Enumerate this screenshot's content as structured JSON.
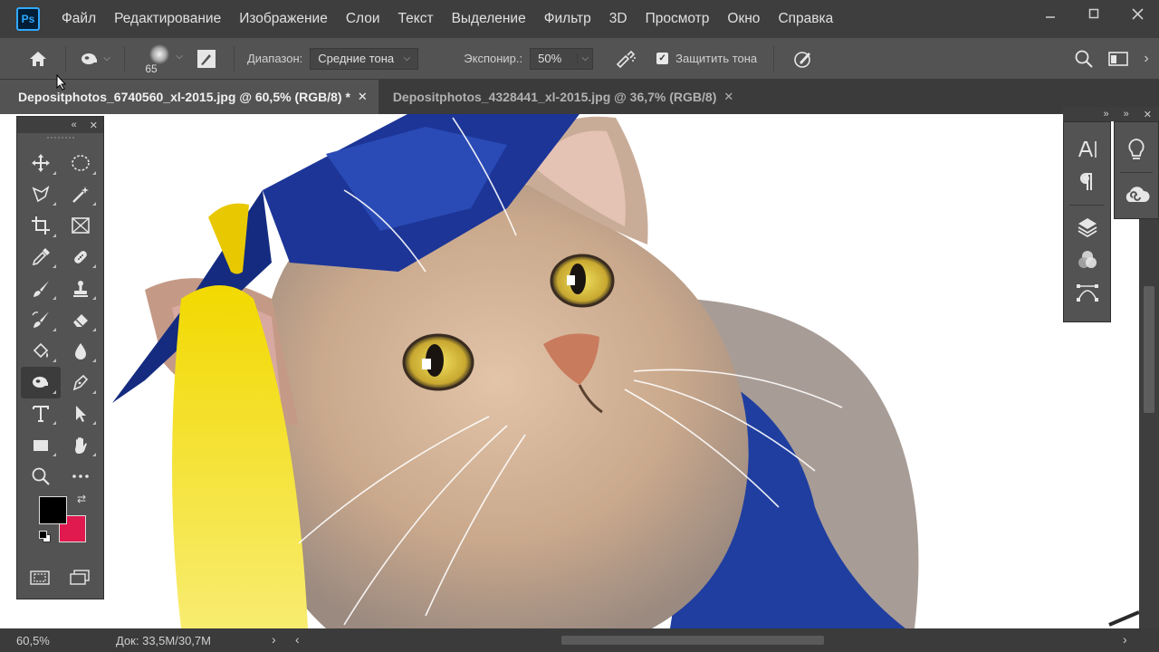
{
  "app": {
    "logo": "Ps"
  },
  "menu": [
    "Файл",
    "Редактирование",
    "Изображение",
    "Слои",
    "Текст",
    "Выделение",
    "Фильтр",
    "3D",
    "Просмотр",
    "Окно",
    "Справка"
  ],
  "options": {
    "brush_size": "65",
    "range_label": "Диапазон:",
    "range_value": "Средние тона",
    "exposure_label": "Экспонир.:",
    "exposure_value": "50%",
    "protect_label": "Защитить тона",
    "protect_checked": true
  },
  "tabs": [
    {
      "label": "Depositphotos_6740560_xl-2015.jpg @ 60,5% (RGB/8) *",
      "active": true
    },
    {
      "label": "Depositphotos_4328441_xl-2015.jpg @ 36,7% (RGB/8)",
      "active": false
    }
  ],
  "status": {
    "zoom": "60,5%",
    "doc": "Док: 33,5M/30,7M"
  },
  "colors": {
    "foreground": "#000000",
    "background": "#e0194f",
    "accent": "#31a8ff"
  },
  "tools": [
    "move",
    "lasso-ellipse",
    "polygonal-lasso",
    "magic-wand",
    "crop",
    "frame",
    "eyedropper",
    "healing-brush",
    "brush",
    "clone-stamp",
    "history-brush",
    "eraser",
    "paint-bucket",
    "blur",
    "dodge",
    "pen",
    "type",
    "path-selection",
    "rectangle",
    "hand",
    "zoom",
    "more"
  ],
  "right_panel_icons": [
    "character-icon",
    "paragraph-icon",
    "layers-icon",
    "channels-icon",
    "paths-icon",
    "learn-icon",
    "libraries-icon"
  ]
}
